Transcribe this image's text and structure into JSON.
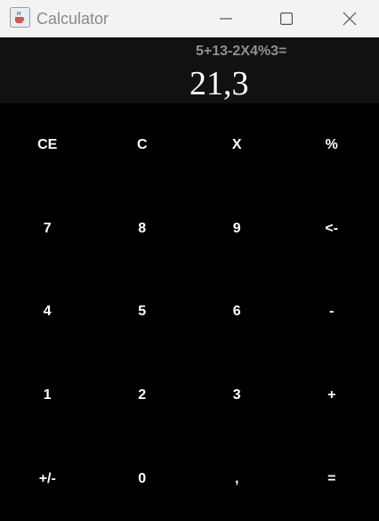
{
  "window": {
    "title": "Calculator",
    "icon": "java-cup-icon",
    "controls": [
      "minimize-icon",
      "maximize-icon",
      "close-icon"
    ]
  },
  "display": {
    "expression": "5+13-2X4%3=",
    "result": "21,3"
  },
  "keypad": {
    "rows": [
      [
        "CE",
        "C",
        "X",
        "%"
      ],
      [
        "7",
        "8",
        "9",
        "<-"
      ],
      [
        "4",
        "5",
        "6",
        "-"
      ],
      [
        "1",
        "2",
        "3",
        "+"
      ],
      [
        "+/-",
        "0",
        ",",
        "="
      ]
    ]
  },
  "colors": {
    "background": "#000000",
    "display_background": "#111111",
    "titlebar": "#f3f3f3",
    "key_text": "#ffffff",
    "expression_text": "#8f8f8f"
  }
}
